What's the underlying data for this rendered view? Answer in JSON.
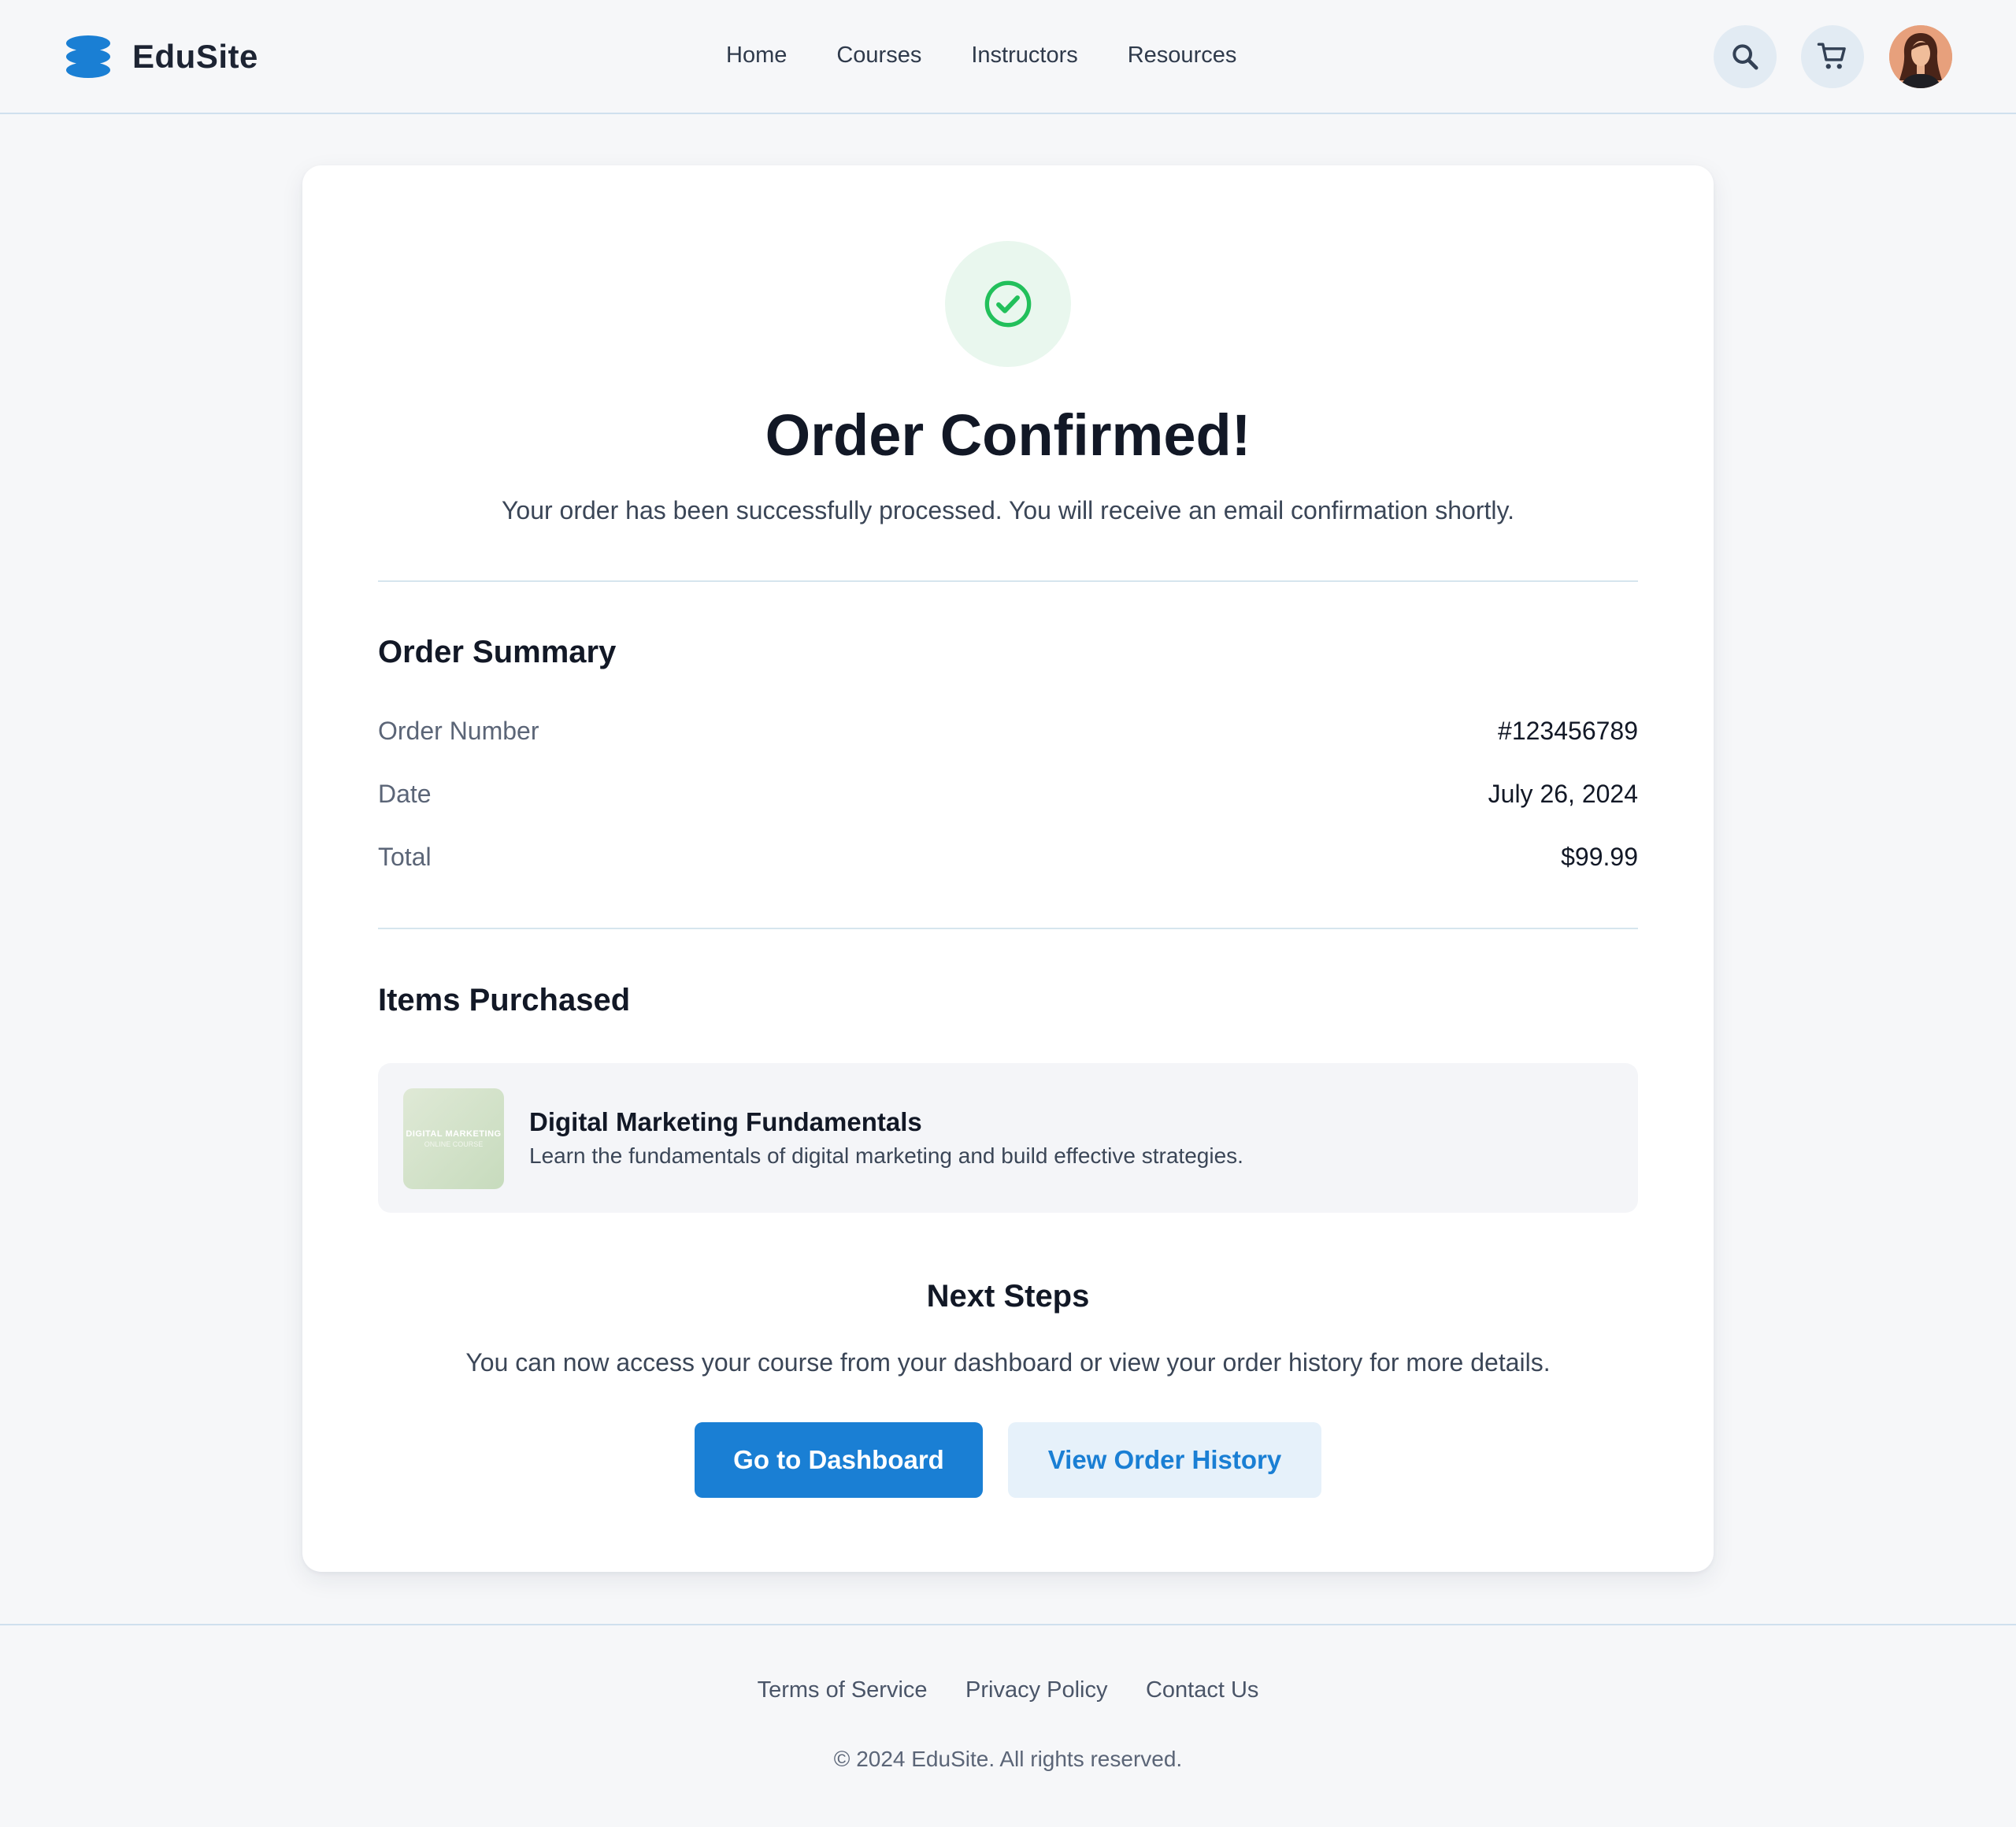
{
  "brand": {
    "name": "EduSite",
    "accent": "#1a7fd4"
  },
  "nav": {
    "items": [
      "Home",
      "Courses",
      "Instructors",
      "Resources"
    ]
  },
  "header_icons": {
    "search": "search-icon",
    "cart": "cart-icon",
    "avatar": "user-avatar"
  },
  "confirmation": {
    "icon": "check-circle-icon",
    "title": "Order Confirmed!",
    "subtitle": "Your order has been successfully processed. You will receive an email confirmation shortly."
  },
  "summary": {
    "heading": "Order Summary",
    "rows": [
      {
        "label": "Order Number",
        "value": "#123456789"
      },
      {
        "label": "Date",
        "value": "July 26, 2024"
      },
      {
        "label": "Total",
        "value": "$99.99"
      }
    ]
  },
  "items": {
    "heading": "Items Purchased",
    "list": [
      {
        "thumb_line1": "DIGITAL MARKETING",
        "thumb_line2": "ONLINE COURSE",
        "name": "Digital Marketing Fundamentals",
        "description": "Learn the fundamentals of digital marketing and build effective strategies."
      }
    ]
  },
  "next_steps": {
    "heading": "Next Steps",
    "text": "You can now access your course from your dashboard or view your order history for more details.",
    "primary_label": "Go to Dashboard",
    "secondary_label": "View Order History"
  },
  "footer": {
    "links": [
      "Terms of Service",
      "Privacy Policy",
      "Contact Us"
    ],
    "copyright": "© 2024 EduSite. All rights reserved."
  }
}
